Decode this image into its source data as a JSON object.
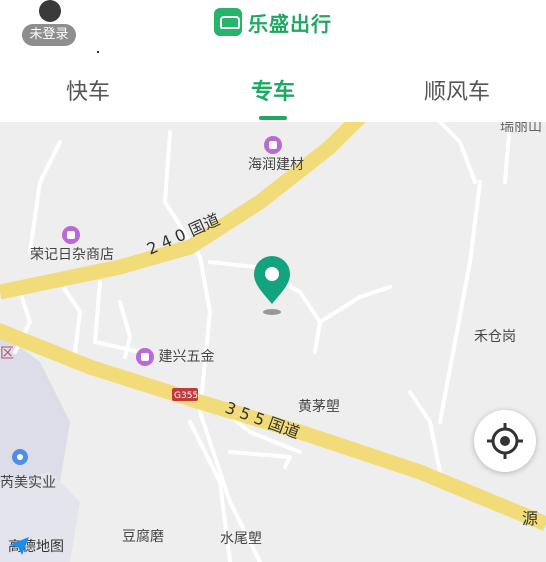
{
  "header": {
    "login_badge": "未登录",
    "app_name": "乐盛出行",
    "tabs": [
      {
        "label": "快车",
        "active": false
      },
      {
        "label": "专车",
        "active": true
      },
      {
        "label": "顺风车",
        "active": false
      }
    ]
  },
  "map": {
    "pois": [
      {
        "label": "海润建材"
      },
      {
        "label": "荣记日杂商店"
      },
      {
        "label": "建兴五金"
      },
      {
        "label": "黄茅塱"
      },
      {
        "label": "禾仓岗"
      },
      {
        "label": "芮美实业"
      },
      {
        "label": "豆腐磨"
      },
      {
        "label": "水尾塱"
      },
      {
        "label": "瑞丽山"
      }
    ],
    "roads": {
      "r240": "2 4 0 国道",
      "r355": "3 5 5 国道",
      "g355_shield": "G355",
      "yuan": "源",
      "qu": "区"
    },
    "provider": "高德地图"
  },
  "colors": {
    "brand_green": "#1fa862",
    "road_yellow": "#f2dc79",
    "map_bg": "#eeeeee"
  }
}
